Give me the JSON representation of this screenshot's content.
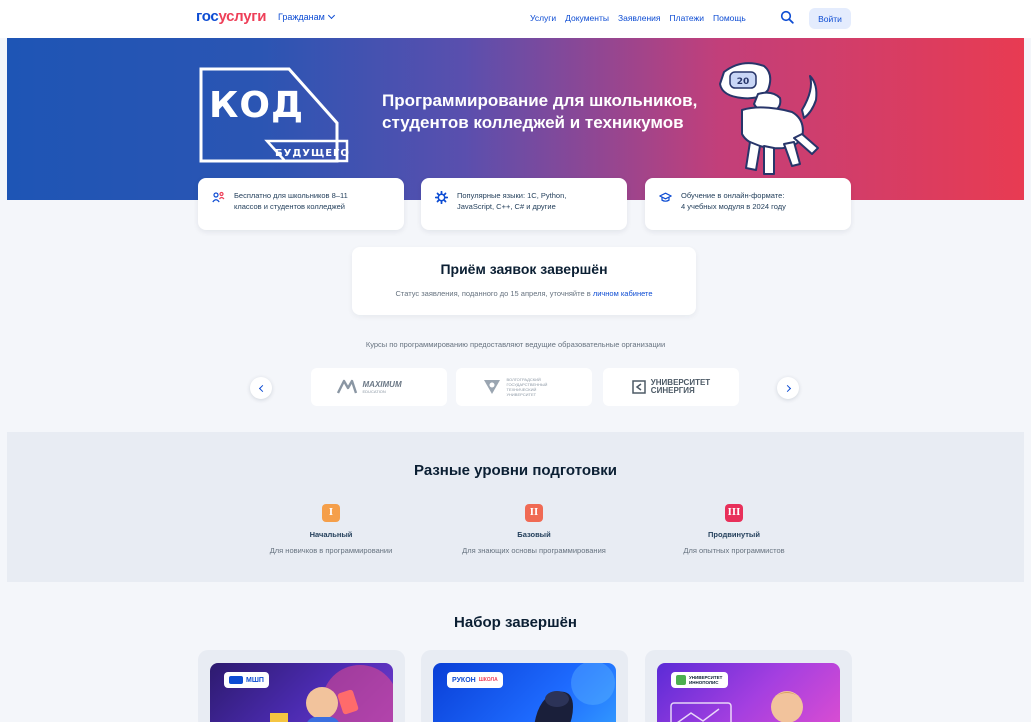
{
  "header": {
    "logo_part1": "гос",
    "logo_part2": "услуги",
    "audience": "Гражданам",
    "nav": [
      "Услуги",
      "Документы",
      "Заявления",
      "Платежи",
      "Помощь"
    ],
    "login": "Войти"
  },
  "hero": {
    "logo_main": "КОД",
    "logo_sub": "БУДУЩЕГО",
    "title_line1": "Программирование для школьников,",
    "title_line2": "студентов колледжей и техникумов",
    "robot_badge": "20"
  },
  "features": [
    {
      "icon": "students-icon",
      "line1": "Бесплатно для школьников 8–11",
      "line2": "классов и студентов колледжей"
    },
    {
      "icon": "gear-icon",
      "line1": "Популярные языки: 1С, Python,",
      "line2": "JavaScript, C++, C# и другие"
    },
    {
      "icon": "graduation-cap-icon",
      "line1": "Обучение в онлайн-формате:",
      "line2": "4 учебных модуля в 2024 году"
    }
  ],
  "closed": {
    "title": "Приём заявок завершён",
    "text": "Статус заявления, поданного до 15 апреля, уточняйте в ",
    "link": "личном кабинете"
  },
  "organizations": {
    "caption": "Курсы по программированию предоставляют ведущие образовательные организации",
    "items": [
      {
        "name": "MAXIMUM",
        "sub": "EDUCATION"
      },
      {
        "name": "ВОЛГОГРАДСКИЙ ГОСУДАРСТВЕННЫЙ ТЕХНИЧЕСКИЙ УНИВЕРСИТЕТ"
      },
      {
        "name": "УНИВЕРСИТЕТ",
        "sub": "СИНЕРГИЯ"
      }
    ]
  },
  "levels": {
    "title": "Разные уровни подготовки",
    "items": [
      {
        "badge": "I",
        "name": "Начальный",
        "desc": "Для новичков в программировании",
        "color": "#f59f4a"
      },
      {
        "badge": "II",
        "name": "Базовый",
        "desc": "Для знающих основы программирования",
        "color": "#f06a54"
      },
      {
        "badge": "III",
        "name": "Продвинутый",
        "desc": "Для опытных программистов",
        "color": "#e8305a"
      }
    ]
  },
  "recruitment": {
    "title": "Набор завершён",
    "courses": [
      {
        "tag": "МШП"
      },
      {
        "tag": "РУКОН",
        "tag_extra": "ШКОЛА"
      },
      {
        "tag": "УНИВЕРСИТЕТ ИННОПОЛИС"
      }
    ]
  },
  "colors": {
    "brand_blue": "#0d4cd3",
    "brand_red": "#ee3f58"
  }
}
